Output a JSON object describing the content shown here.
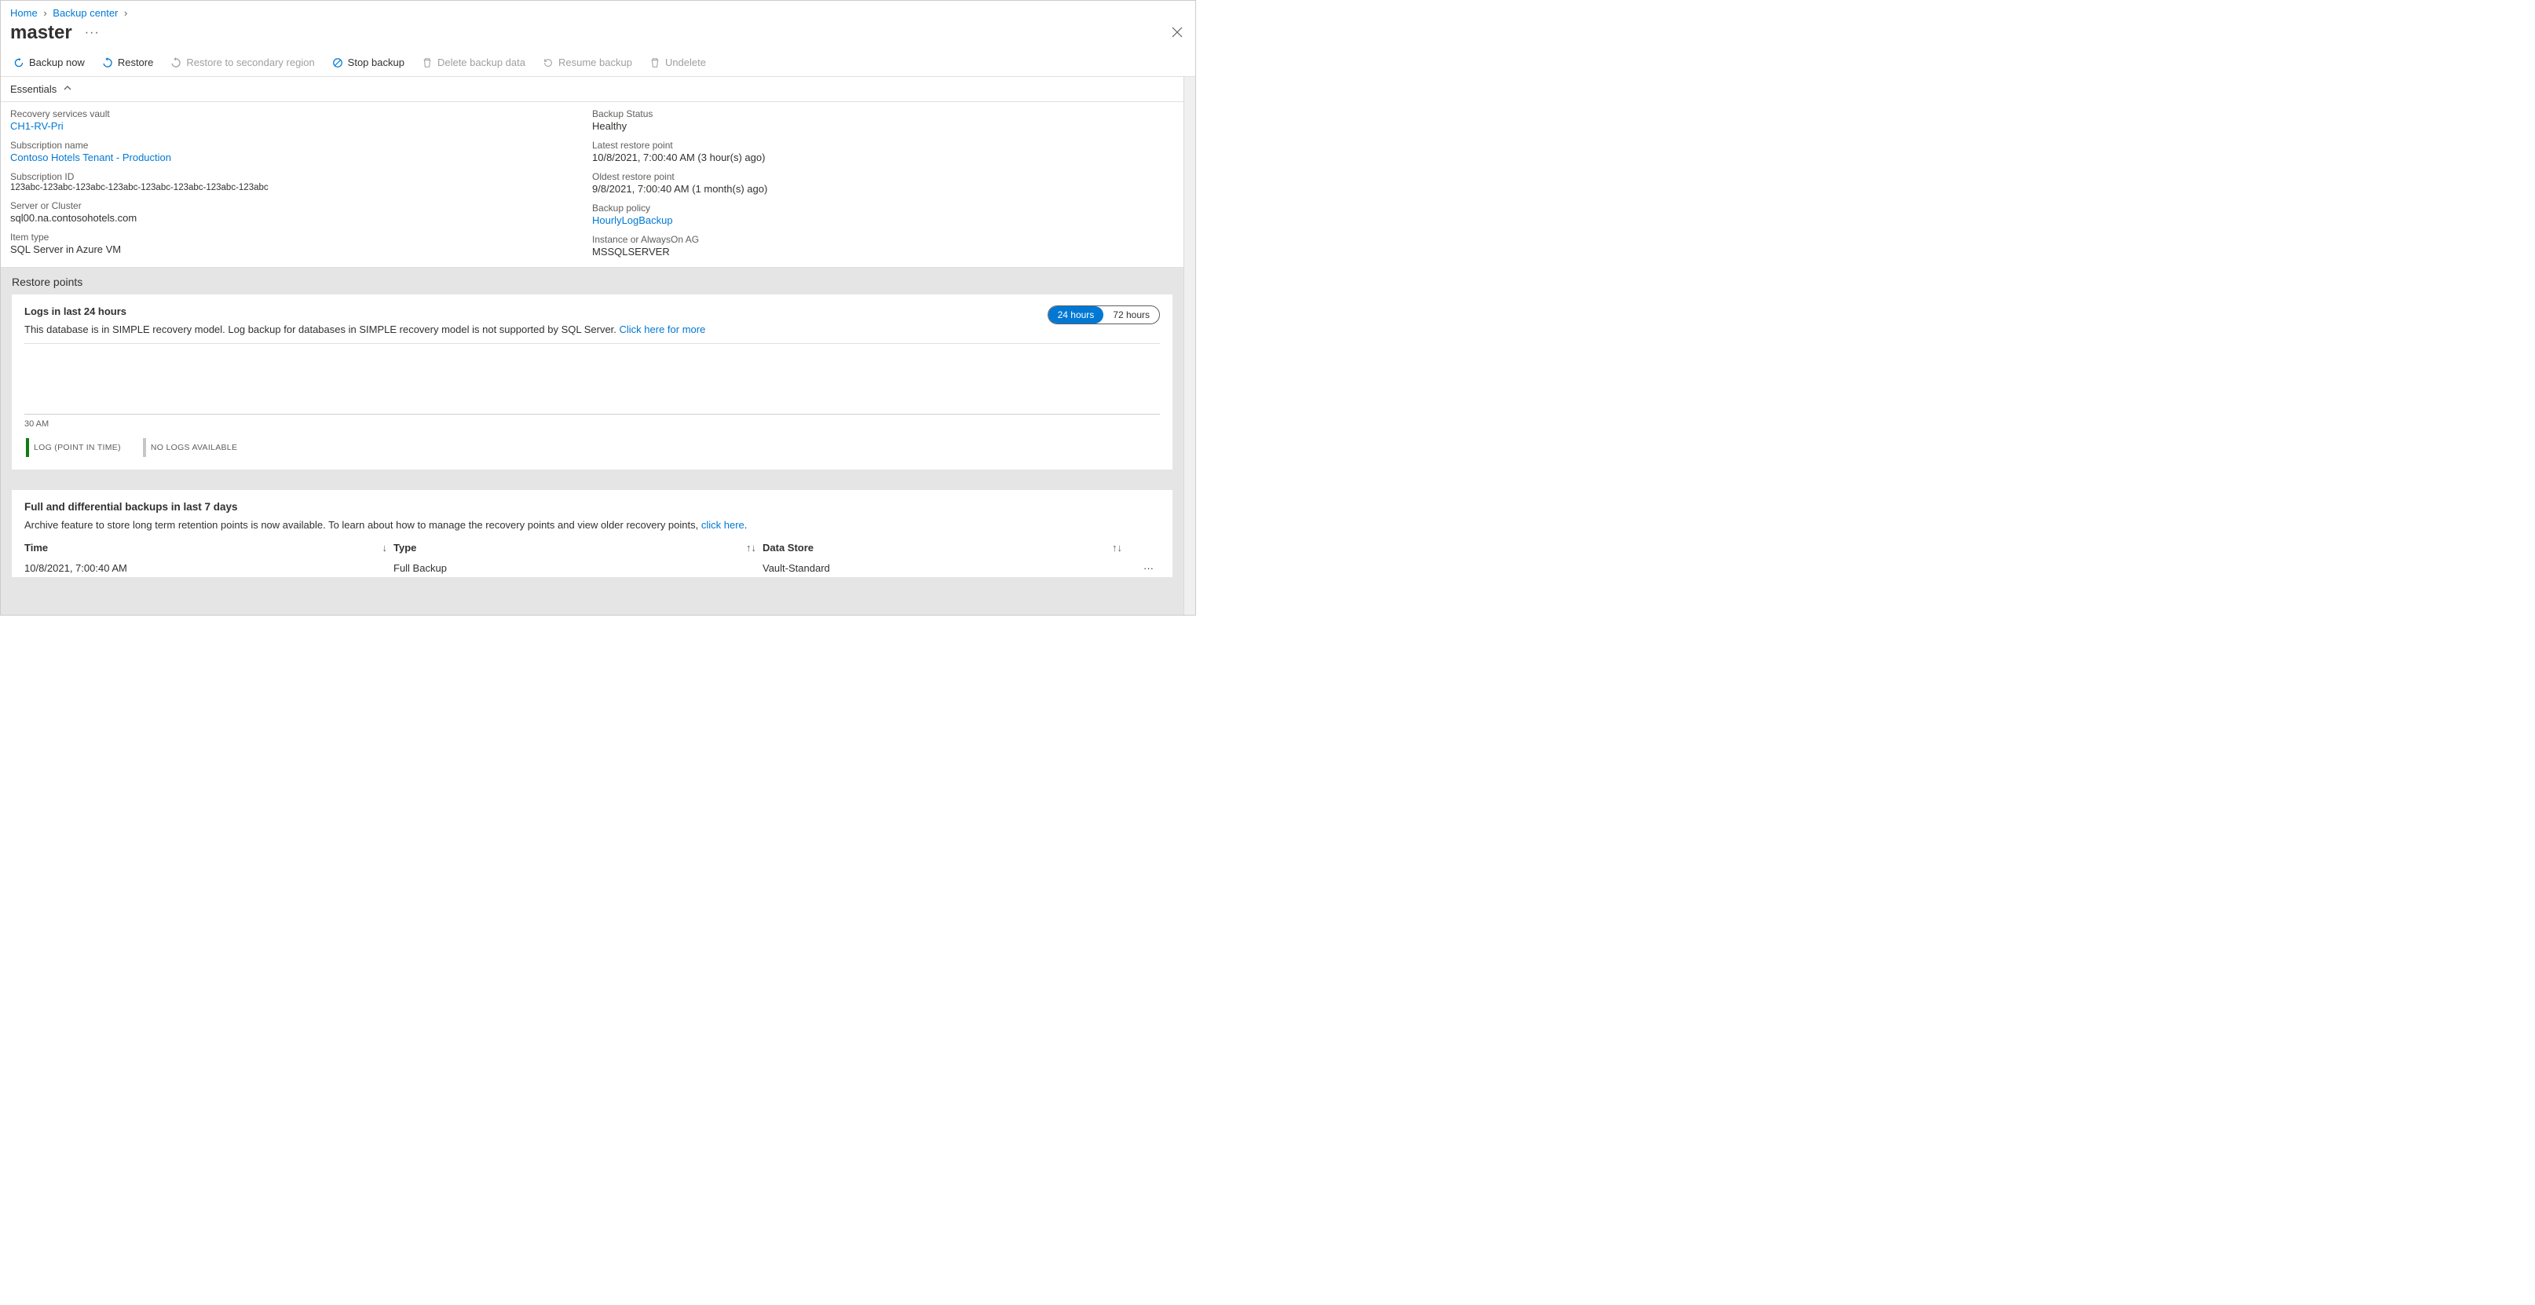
{
  "breadcrumb": {
    "home": "Home",
    "backup_center": "Backup center"
  },
  "title": "master",
  "toolbar": {
    "backup_now": "Backup now",
    "restore": "Restore",
    "restore_secondary": "Restore to secondary region",
    "stop_backup": "Stop backup",
    "delete_data": "Delete backup data",
    "resume": "Resume backup",
    "undelete": "Undelete"
  },
  "essentials": {
    "heading": "Essentials",
    "left": {
      "vault_label": "Recovery services vault",
      "vault_value": "CH1-RV-Pri",
      "sub_name_label": "Subscription name",
      "sub_name_value": "Contoso Hotels Tenant - Production",
      "sub_id_label": "Subscription ID",
      "sub_id_value": "123abc-123abc-123abc-123abc-123abc-123abc-123abc-123abc",
      "server_label": "Server or Cluster",
      "server_value": "sql00.na.contosohotels.com",
      "item_type_label": "Item type",
      "item_type_value": "SQL Server in Azure VM"
    },
    "right": {
      "status_label": "Backup Status",
      "status_value": "Healthy",
      "latest_label": "Latest restore point",
      "latest_value": "10/8/2021, 7:00:40 AM (3 hour(s) ago)",
      "oldest_label": "Oldest restore point",
      "oldest_value": "9/8/2021, 7:00:40 AM (1 month(s) ago)",
      "policy_label": "Backup policy",
      "policy_value": "HourlyLogBackup",
      "instance_label": "Instance or AlwaysOn AG",
      "instance_value": "MSSQLSERVER"
    }
  },
  "restore_points_heading": "Restore points",
  "logs_card": {
    "title": "Logs in last 24 hours",
    "desc_pre": "This database is in SIMPLE recovery model. Log backup for databases in SIMPLE recovery model is not supported by SQL Server. ",
    "desc_link": "Click here for more",
    "toggle_24": "24 hours",
    "toggle_72": "72 hours",
    "tick": "30 AM",
    "legend1": "LOG (POINT IN TIME)",
    "legend2": "NO LOGS AVAILABLE"
  },
  "fd_card": {
    "title": "Full and differential backups in last 7 days",
    "desc_pre": "Archive feature to store long term retention points is now available. To learn about how to manage the recovery points and view older recovery points, ",
    "desc_link": "click here",
    "desc_post": ".",
    "cols": {
      "time": "Time",
      "type": "Type",
      "ds": "Data Store"
    },
    "row": {
      "time": "10/8/2021, 7:00:40 AM",
      "type": "Full Backup",
      "ds": "Vault-Standard"
    }
  }
}
